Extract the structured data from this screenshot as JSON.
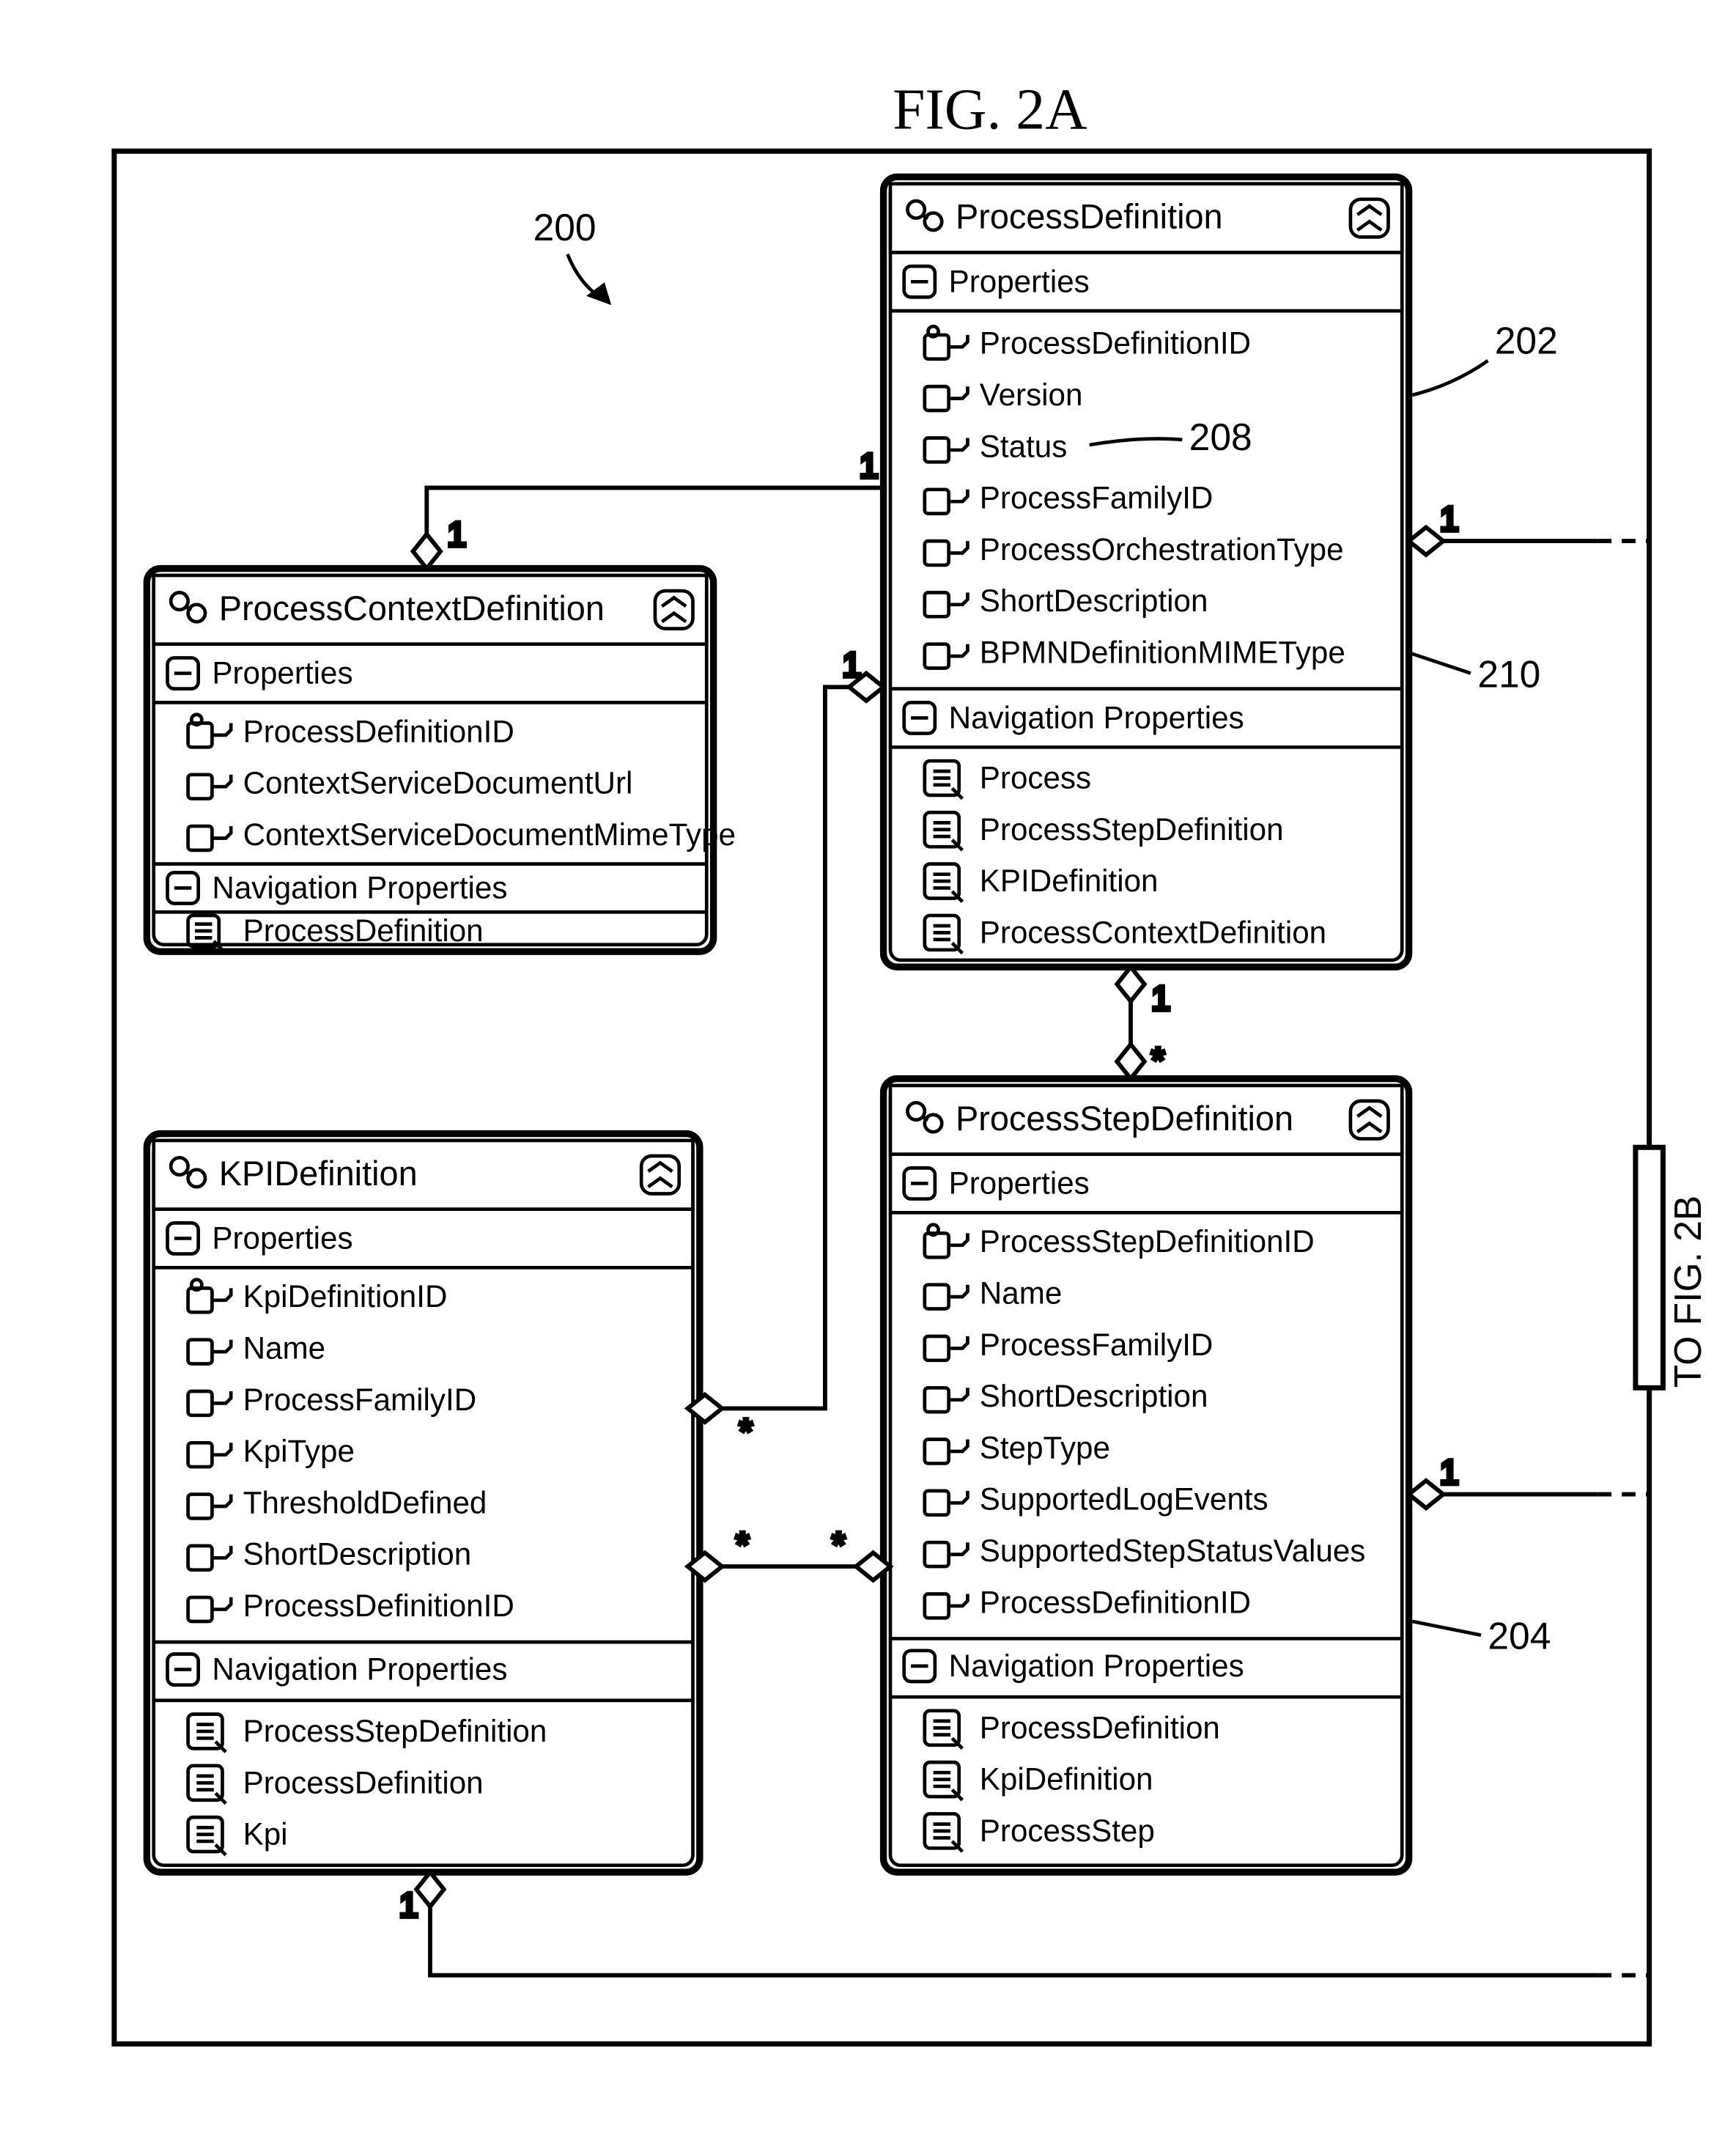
{
  "figure_title": "FIG. 2A",
  "refs": {
    "r200": "200",
    "r202": "202",
    "r204": "204",
    "r208": "208",
    "r210": "210"
  },
  "multiplicities": {
    "one_a": "1",
    "one_b": "1",
    "one_c": "1",
    "one_d": "1",
    "one_e": "1",
    "one_f": "1",
    "star_a": "*",
    "star_b": "*",
    "star_c": "*",
    "star_d": "*"
  },
  "to_fig": "TO FIG. 2B",
  "entities": {
    "contextDef": {
      "title": "ProcessContextDefinition",
      "sections": [
        {
          "label": "Properties",
          "items": [
            {
              "icon": "key",
              "text": "ProcessDefinitionID"
            },
            {
              "icon": "prop",
              "text": "ContextServiceDocumentUrl"
            },
            {
              "icon": "prop",
              "text": "ContextServiceDocumentMimeType"
            }
          ]
        },
        {
          "label": "Navigation Properties",
          "items": [
            {
              "icon": "nav",
              "text": "ProcessDefinition"
            }
          ]
        }
      ]
    },
    "kpiDef": {
      "title": "KPIDefinition",
      "sections": [
        {
          "label": "Properties",
          "items": [
            {
              "icon": "key",
              "text": "KpiDefinitionID"
            },
            {
              "icon": "prop",
              "text": "Name"
            },
            {
              "icon": "prop",
              "text": "ProcessFamilyID"
            },
            {
              "icon": "prop",
              "text": "KpiType"
            },
            {
              "icon": "prop",
              "text": "ThresholdDefined"
            },
            {
              "icon": "prop",
              "text": "ShortDescription"
            },
            {
              "icon": "prop",
              "text": "ProcessDefinitionID"
            }
          ]
        },
        {
          "label": "Navigation Properties",
          "items": [
            {
              "icon": "nav",
              "text": "ProcessStepDefinition"
            },
            {
              "icon": "nav",
              "text": "ProcessDefinition"
            },
            {
              "icon": "nav",
              "text": "Kpi"
            }
          ]
        }
      ]
    },
    "processDef": {
      "title": "ProcessDefinition",
      "sections": [
        {
          "label": "Properties",
          "items": [
            {
              "icon": "key",
              "text": "ProcessDefinitionID"
            },
            {
              "icon": "prop",
              "text": "Version"
            },
            {
              "icon": "prop",
              "text": "Status"
            },
            {
              "icon": "prop",
              "text": "ProcessFamilyID"
            },
            {
              "icon": "prop",
              "text": "ProcessOrchestrationType"
            },
            {
              "icon": "prop",
              "text": "ShortDescription"
            },
            {
              "icon": "prop",
              "text": "BPMNDefinitionMIMEType"
            }
          ]
        },
        {
          "label": "Navigation Properties",
          "items": [
            {
              "icon": "nav",
              "text": "Process"
            },
            {
              "icon": "nav",
              "text": "ProcessStepDefinition"
            },
            {
              "icon": "nav",
              "text": "KPIDefinition"
            },
            {
              "icon": "nav",
              "text": "ProcessContextDefinition"
            }
          ]
        }
      ]
    },
    "stepDef": {
      "title": "ProcessStepDefinition",
      "sections": [
        {
          "label": "Properties",
          "items": [
            {
              "icon": "key",
              "text": "ProcessStepDefinitionID"
            },
            {
              "icon": "prop",
              "text": "Name"
            },
            {
              "icon": "prop",
              "text": "ProcessFamilyID"
            },
            {
              "icon": "prop",
              "text": "ShortDescription"
            },
            {
              "icon": "prop",
              "text": "StepType"
            },
            {
              "icon": "prop",
              "text": "SupportedLogEvents"
            },
            {
              "icon": "prop",
              "text": "SupportedStepStatusValues"
            },
            {
              "icon": "prop",
              "text": "ProcessDefinitionID"
            }
          ]
        },
        {
          "label": "Navigation Properties",
          "items": [
            {
              "icon": "nav",
              "text": "ProcessDefinition"
            },
            {
              "icon": "nav",
              "text": "KpiDefinition"
            },
            {
              "icon": "nav",
              "text": "ProcessStep"
            }
          ]
        }
      ]
    }
  }
}
